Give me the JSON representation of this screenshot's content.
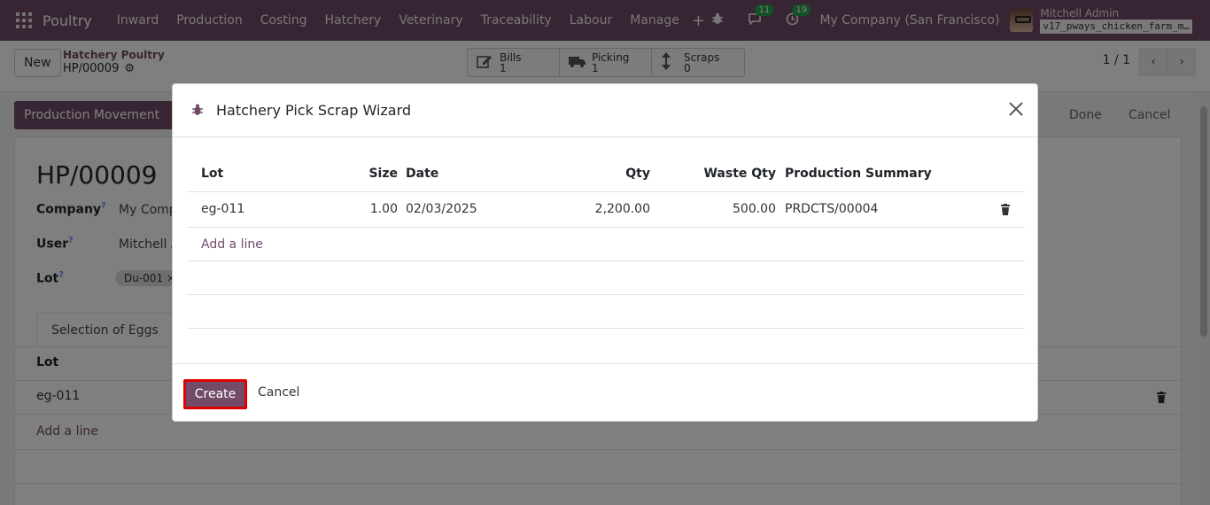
{
  "navbar": {
    "brand": "Poultry",
    "menu": [
      "Inward",
      "Production",
      "Costing",
      "Hatchery",
      "Veterinary",
      "Traceability",
      "Labour",
      "Manage"
    ],
    "plus": "+",
    "messages_count": "11",
    "activities_count": "19",
    "company": "My Company (San Francisco)",
    "user_name": "Mitchell Admin",
    "database": "v17_pways_chicken_farm_m…"
  },
  "control": {
    "new_label": "New",
    "breadcrumb_parent": "Hatchery Poultry",
    "breadcrumb_current": "HP/00009",
    "stats": [
      {
        "label": "Bills",
        "value": "1",
        "icon": "edit-icon"
      },
      {
        "label": "Picking",
        "value": "1",
        "icon": "truck-icon"
      },
      {
        "label": "Scraps",
        "value": "0",
        "icon": "arrows-vertical-icon"
      }
    ],
    "pager": "1 / 1"
  },
  "form": {
    "production_movement_label": "Production Movement",
    "stage_done": "Done",
    "stage_cancel": "Cancel",
    "title": "HP/00009",
    "company_label": "Company",
    "company_value": "My Comp",
    "user_label": "User",
    "user_value": "Mitchell A",
    "lot_label": "Lot",
    "lot_tag": "Du-001",
    "help_mark": "?",
    "tab_label": "Selection of Eggs",
    "col_lot": "Lot",
    "row_lot": "eg-011",
    "add_line": "Add a line"
  },
  "modal": {
    "title": "Hatchery Pick Scrap Wizard",
    "columns": {
      "lot": "Lot",
      "size": "Size",
      "date": "Date",
      "qty": "Qty",
      "waste_qty": "Waste Qty",
      "production_summary": "Production Summary"
    },
    "rows": [
      {
        "lot": "eg-011",
        "size": "1.00",
        "date": "02/03/2025",
        "qty": "2,200.00",
        "waste_qty": "500.00",
        "production_summary": "PRDCTS/00004"
      }
    ],
    "add_line": "Add a line",
    "create_label": "Create",
    "cancel_label": "Cancel"
  },
  "colors": {
    "brand": "#714b67",
    "badge": "#22a34a",
    "highlight": "#e00000"
  }
}
